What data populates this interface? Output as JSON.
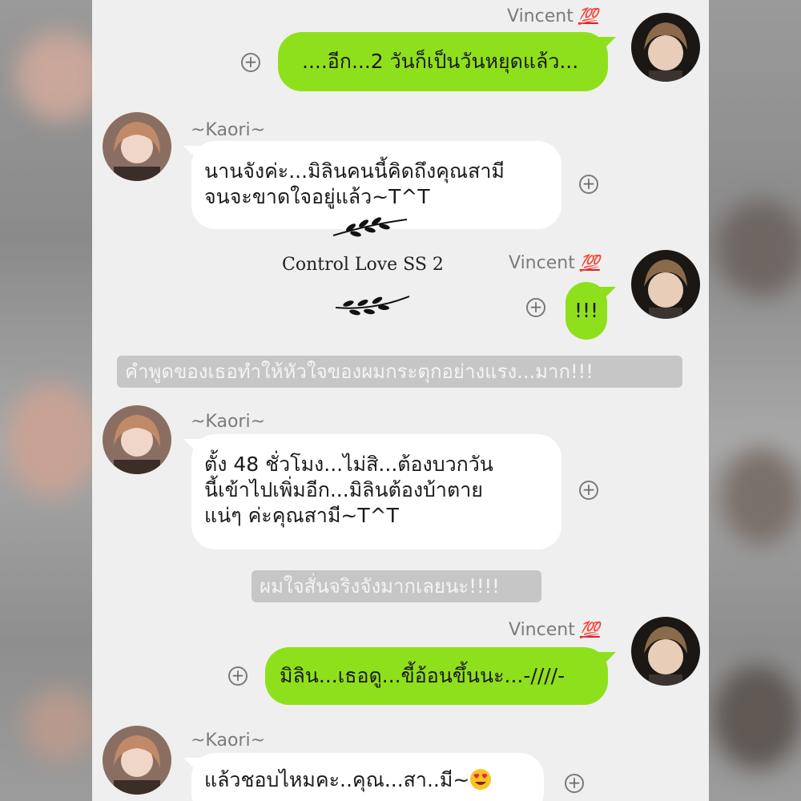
{
  "messages": [
    {
      "sender": "Vincent",
      "badge": "💯",
      "side": "right",
      "lines": [
        "....อีก...2 วันก็เป็นวันหยุดแล้ว..."
      ]
    },
    {
      "sender": "~Kaori~",
      "side": "left",
      "lines": [
        "นานจังค่ะ...มิลินคนนี้คิดถึงคุณสามี",
        "จนจะขาดใจอยู่แล้ว~T^T"
      ]
    },
    {
      "sender": "Vincent",
      "badge": "💯",
      "side": "right",
      "lines": [
        "!!!"
      ]
    },
    {
      "sender": "~Kaori~",
      "side": "left",
      "lines": [
        "ตั้ง 48 ชั่วโมง...ไม่สิ...ต้องบวกวัน",
        "นี้เข้าไปเพิ่มอีก...มิลินต้องบ้าตาย",
        "แน่ๆ ค่ะคุณสามี~T^T"
      ]
    },
    {
      "sender": "Vincent",
      "badge": "💯",
      "side": "right",
      "lines": [
        "มิลิน...เธอดู...ขี้อ้อนขึ้นนะ...-////-"
      ]
    },
    {
      "sender": "~Kaori~",
      "side": "left",
      "lines": [
        "แล้วชอบไหมคะ..คุณ...สา..มี~"
      ],
      "emoji": "heart-eyes-emoji"
    }
  ],
  "narrations": [
    "คำพูดของเธอทำให้หัวใจของผมกระตุกอย่างแรง...มาก!!!",
    "ผมใจสั่นจริงจังมากเลยนะ!!!!"
  ],
  "decoration": {
    "title": "Control Love SS 2"
  },
  "icons": {
    "add": "plus-circle-icon",
    "emoji": "heart-eyes-emoji"
  },
  "colors": {
    "outgoing_bubble": "#8fe01c",
    "incoming_bubble": "#ffffff",
    "background": "#efefef",
    "narration": "#c6c6c6",
    "badge": "#e0192b"
  }
}
